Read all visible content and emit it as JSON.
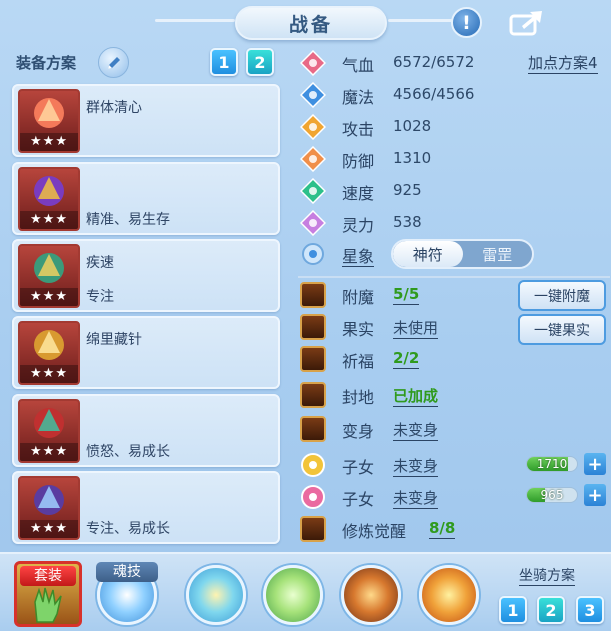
{
  "header": {
    "title": "战备",
    "warn_icon": "exclamation-icon",
    "share_icon": "share-icon"
  },
  "left": {
    "plan_label": "装备方案",
    "plan_buttons": [
      "1",
      "2"
    ],
    "selected_plan": "2",
    "cards": [
      {
        "line1": "群体清心",
        "line2": "",
        "stars": "★★★"
      },
      {
        "line1": "",
        "line2": "精准、易生存",
        "stars": "★★★"
      },
      {
        "line1": "疾速",
        "line2": "专注",
        "stars": "★★★"
      },
      {
        "line1": "绵里藏针",
        "line2": "",
        "stars": "★★★"
      },
      {
        "line1": "",
        "line2": "愤怒、易成长",
        "stars": "★★★"
      },
      {
        "line1": "",
        "line2": "专注、易成长",
        "stars": "★★★"
      }
    ]
  },
  "stats": {
    "add_plan_link": "加点方案4",
    "rows": [
      {
        "name": "气血",
        "value": "6572/6572",
        "icon": "heart-icon",
        "color": "#e86a87"
      },
      {
        "name": "魔法",
        "value": "4566/4566",
        "icon": "mana-icon",
        "color": "#3f8fe0"
      },
      {
        "name": "攻击",
        "value": "1028",
        "icon": "sword-icon",
        "color": "#f0a531"
      },
      {
        "name": "防御",
        "value": "1310",
        "icon": "shield-icon",
        "color": "#f08f4a"
      },
      {
        "name": "速度",
        "value": "925",
        "icon": "lightning-icon",
        "color": "#2cc08a"
      },
      {
        "name": "灵力",
        "value": "538",
        "icon": "spirit-icon",
        "color": "#c77fe0"
      }
    ],
    "star_label": "星象",
    "star_options": [
      "神符",
      "雷罡"
    ],
    "star_selected": "神符"
  },
  "enhance": {
    "rows": [
      {
        "name": "附魔",
        "value": "5/5",
        "value_style": "green"
      },
      {
        "name": "果实",
        "value": "未使用",
        "value_style": "plain"
      },
      {
        "name": "祈福",
        "value": "2/2",
        "value_style": "green"
      },
      {
        "name": "封地",
        "value": "已加成",
        "value_style": "green"
      },
      {
        "name": "变身",
        "value": "未变身",
        "value_style": "plain"
      },
      {
        "name": "子女",
        "value": "未变身",
        "value_style": "plain"
      },
      {
        "name": "子女",
        "value": "未变身",
        "value_style": "plain"
      },
      {
        "name": "修炼觉醒",
        "value": "8/8",
        "value_style": "green"
      }
    ],
    "btn_enchant": "一键附魔",
    "btn_fruit": "一键果实",
    "child_bars": [
      {
        "value": "1710",
        "fill": 0.82
      },
      {
        "value": "965",
        "fill": 0.35
      }
    ],
    "plus_label": "+"
  },
  "bottom": {
    "tab_set": "套装",
    "tab_soul": "魂技",
    "mount_label": "坐骑方案",
    "mount_buttons": [
      "1",
      "2",
      "3"
    ],
    "selected_mount": "2"
  }
}
